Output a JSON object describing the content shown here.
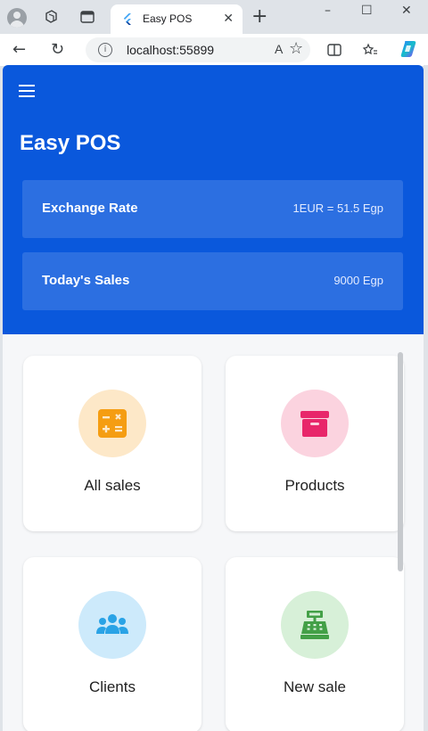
{
  "browser": {
    "tab_title": "Easy POS",
    "url": "localhost:55899",
    "new_tab_glyph": "+",
    "close_glyph": "✕",
    "minimize_glyph": "–",
    "maximize_glyph": "☐",
    "window_close_glyph": "✕",
    "read_aloud_glyph": "A",
    "favorite_glyph": "☆"
  },
  "app": {
    "title": "Easy POS",
    "primary_color": "#0a58dc",
    "info_cards": [
      {
        "label": "Exchange Rate",
        "value": "1EUR = 51.5 Egp"
      },
      {
        "label": "Today's Sales",
        "value": "9000 Egp"
      }
    ],
    "tiles": [
      {
        "label": "All sales",
        "icon": "calculator-icon",
        "circle_color": "#fde8c8",
        "icon_color": "#f59d12"
      },
      {
        "label": "Products",
        "icon": "archive-box-icon",
        "circle_color": "#fbd3df",
        "icon_color": "#e8266a"
      },
      {
        "label": "Clients",
        "icon": "group-icon",
        "circle_color": "#cdeafb",
        "icon_color": "#2aa3e6"
      },
      {
        "label": "New sale",
        "icon": "cash-register-icon",
        "circle_color": "#d7f0d8",
        "icon_color": "#43a047"
      }
    ]
  }
}
